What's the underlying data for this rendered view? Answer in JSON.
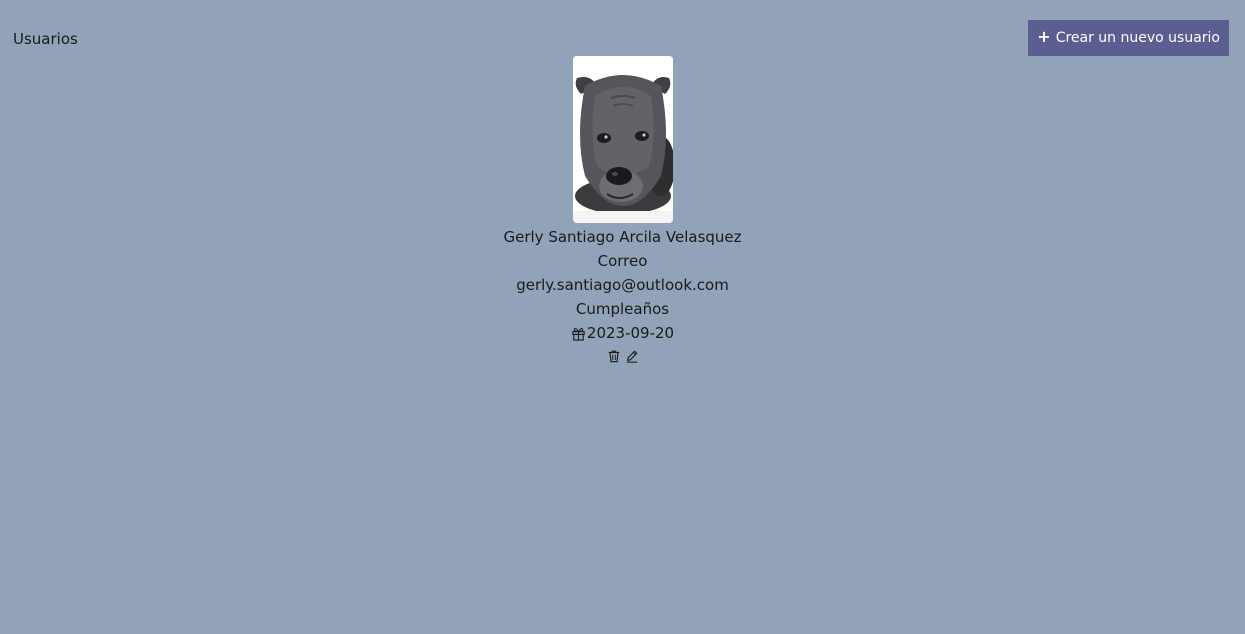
{
  "header": {
    "title": "Usuarios",
    "create_button_label": "Crear un nuevo usuario",
    "create_button_icon": "plus-icon"
  },
  "user": {
    "name": "Gerly Santiago Arcila Velasquez",
    "email_label": "Correo",
    "email": "gerly.santiago@outlook.com",
    "birthday_label": "Cumpleaños",
    "birthday": "2023-09-20",
    "avatar_description": "grey dog photo",
    "birthday_icon": "gift-icon",
    "actions": [
      {
        "icon": "trash-icon"
      },
      {
        "icon": "pencil-icon"
      }
    ]
  },
  "colors": {
    "background": "#92a2b8",
    "button": "#5a5e91",
    "button_text": "#ffffff"
  }
}
